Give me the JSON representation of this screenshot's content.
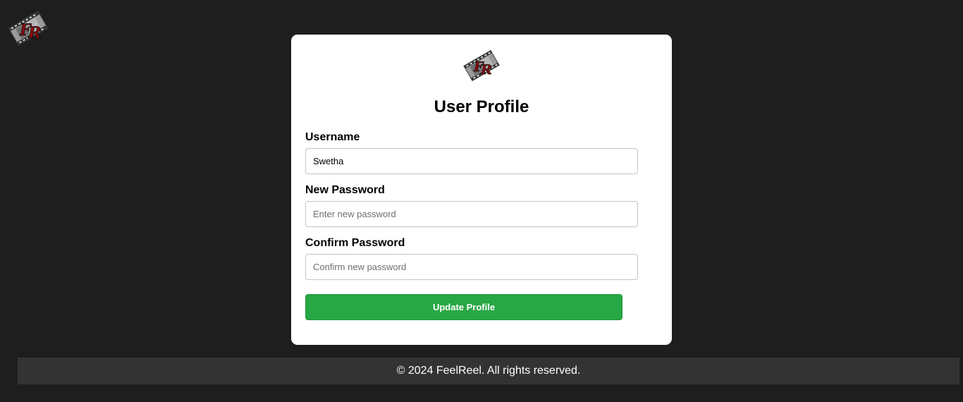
{
  "app": {
    "logo_icon": "feelreel-film-logo-icon"
  },
  "profile": {
    "title": "User Profile",
    "username_label": "Username",
    "username_value": "Swetha",
    "new_password_label": "New Password",
    "new_password_placeholder": "Enter new password",
    "confirm_password_label": "Confirm Password",
    "confirm_password_placeholder": "Confirm new password",
    "submit_label": "Update Profile"
  },
  "footer": {
    "text": "© 2024 FeelReel. All rights reserved."
  },
  "colors": {
    "background": "#1e1e1e",
    "card": "#ffffff",
    "button": "#28a745",
    "footer": "#333333",
    "logo_red": "#8b0a0f"
  }
}
